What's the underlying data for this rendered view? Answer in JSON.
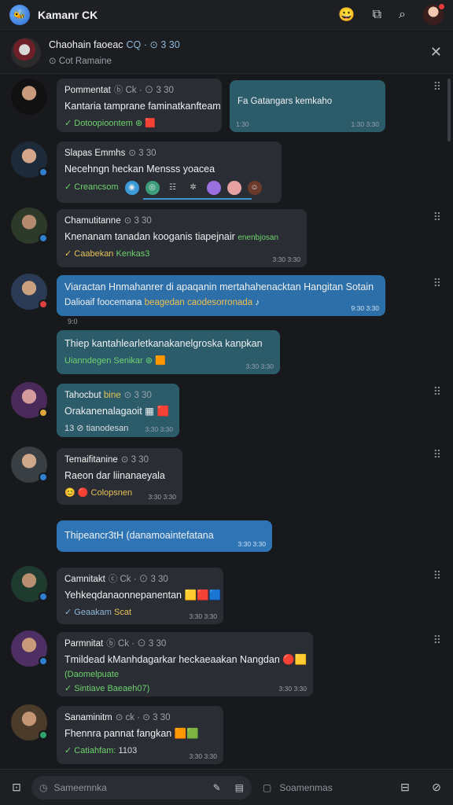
{
  "app": {
    "title": "Kamanr CK"
  },
  "chat": {
    "name": "Chaohain faoeac",
    "ids": "CQ · ⊙ 3 30",
    "subtitle": "Cot Ramaine"
  },
  "messages": [
    {
      "sender": "Pommentat",
      "meta": "ⓑ Ck · ⊙ 3 30",
      "text": "Kantaria tamprane faminatkanfteam",
      "sub": "✓ Dotoopioontem",
      "ts": ""
    },
    {
      "text": "Fa Gatangars kemkaho",
      "left_ts": "1:30",
      "ts": "1:30 3:30"
    },
    {
      "sender": "Slapas Emmhs",
      "meta": "⊙ 3 30",
      "text": "Necehngn heckan Mensss yoacea",
      "sub": "✓ Creancsom",
      "ts": ""
    },
    {
      "sender": "Chamutitanne",
      "meta": "⊙ 3 30",
      "text": "Knenanam tanadan kooganis tiapejnair",
      "text_extra": "enenbjosan",
      "sub": "✓ Caabekan",
      "sub_extra": "Kenkas3",
      "ts": "3:30 3:30"
    },
    {
      "text": "Viaractan Hnmahanrer di apaqanin mertahahenacktan Hangitan Sotain",
      "text2": "Dalioaif foocemana",
      "text2_extra": "beagedan",
      "text2_extra2": "caodesorronada",
      "ts": "9:30 3:30",
      "below": "9:0"
    },
    {
      "text": "Thiep kantahlearletkanakanelgroska kanpkan",
      "sub": "Uianndegen Senikar",
      "ts": "3:30 3:30"
    },
    {
      "sender": "Tahocbut",
      "sender_extra": "bine",
      "meta": "⊙ 3 30",
      "text": "Orakanenalagaoit",
      "sub": "13 ⊘ tianodesan",
      "ts": "3:30 3:30"
    },
    {
      "sender": "Temaifitanine",
      "meta": "⊙ 3 30",
      "text": "Raeon dar liinanaeyala",
      "sub": "Colopsnen",
      "ts": "3:30 3:30"
    },
    {
      "text": "Thipeancr3tH (danamoaintefatana",
      "ts": "3:30 3:30"
    },
    {
      "sender": "Camnitakt",
      "meta": "ⓒ Ck · ⊙ 3 30",
      "text": "Yehkeqdanaonnepanentan",
      "sub": "✓ Geaakam",
      "sub_extra": "Scat",
      "ts": "3:30 3:30"
    },
    {
      "sender": "Parmnitat",
      "meta": "ⓑ Ck · ⊙ 3 30",
      "text": "Tmildead kManhdagarkar heckaeaakan Nangdan",
      "sub": "(Daomelpuate",
      "sub2": "✓ Sintiave Baeaeh07)",
      "ts": "3:30 3:30"
    },
    {
      "sender": "Sanaminitm",
      "meta": "⊙ ck · ⊙ 3 30",
      "text": "Fhennra pannat fangkan",
      "sub": "✓ Catiahfam:",
      "sub_extra": "1103",
      "ts": "3:30 3:30"
    }
  ],
  "composer": {
    "placeholder": "Sameemnka",
    "placeholder2": "Soamenmas"
  },
  "colors": {
    "accent": "#2d6fa8",
    "green": "#6ed36e",
    "background": "#17191c"
  }
}
